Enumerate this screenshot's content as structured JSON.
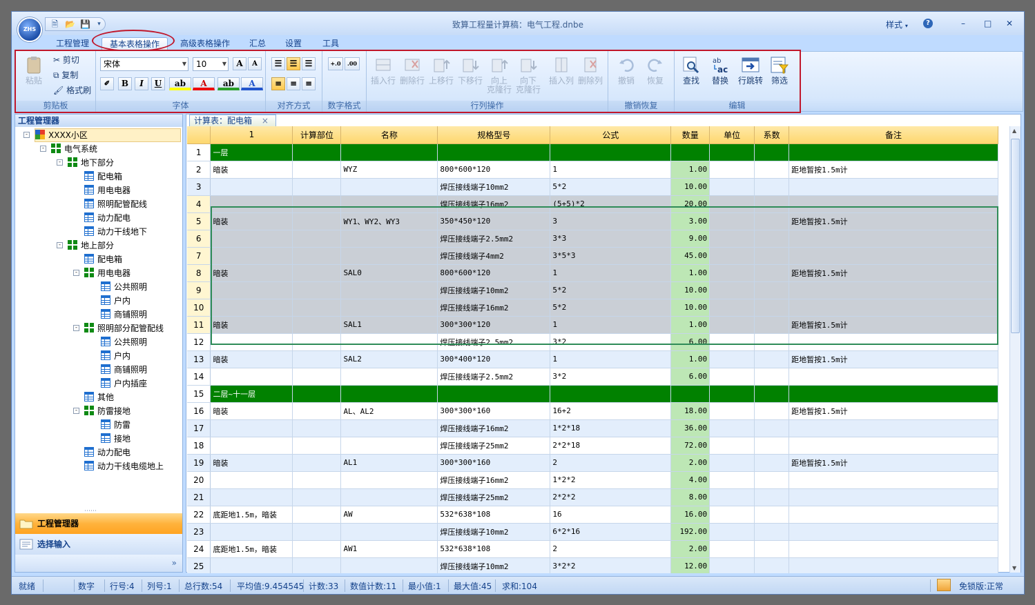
{
  "window": {
    "title": "致算工程量计算稿：电气工程.dnbe",
    "style_label": "样式"
  },
  "qat": {
    "new": "new-doc-icon",
    "open": "open-folder-icon",
    "save": "save-icon"
  },
  "logo_text": "ZHS",
  "tabs": [
    "工程管理",
    "基本表格操作",
    "高级表格操作",
    "汇总",
    "设置",
    "工具"
  ],
  "ribbon": {
    "clipboard": {
      "label": "剪贴板",
      "paste": "粘贴",
      "cut": "剪切",
      "copy": "复制",
      "format_painter": "格式刷"
    },
    "font": {
      "label": "字体",
      "family": "宋体",
      "size": "10"
    },
    "align": {
      "label": "对齐方式"
    },
    "numfmt": {
      "label": "数字格式"
    },
    "rowcol": {
      "label": "行列操作",
      "insert_row": "插入行",
      "delete_row": "删除行",
      "move_up": "上移行",
      "move_down": "下移行",
      "copy_up_1": "向上",
      "copy_up_2": "克隆行",
      "copy_down_1": "向下",
      "copy_down_2": "克隆行",
      "insert_col": "插入列",
      "delete_col": "删除列"
    },
    "undo": {
      "label": "撤销恢复",
      "undo": "撤销",
      "redo": "恢复"
    },
    "edit": {
      "label": "编辑",
      "find": "查找",
      "replace": "替换",
      "goto": "行跳转",
      "filter": "筛选"
    }
  },
  "left_panel": {
    "header": "工程管理器",
    "tree": [
      {
        "label": "XXXX小区",
        "level": 0,
        "icon": "multi",
        "expander": "-",
        "selected": true
      },
      {
        "label": "电气系统",
        "level": 1,
        "icon": "green",
        "expander": "-"
      },
      {
        "label": "地下部分",
        "level": 2,
        "icon": "green",
        "expander": "-"
      },
      {
        "label": "配电箱",
        "level": 3,
        "icon": "grid"
      },
      {
        "label": "用电电器",
        "level": 3,
        "icon": "grid"
      },
      {
        "label": "照明配管配线",
        "level": 3,
        "icon": "grid"
      },
      {
        "label": "动力配电",
        "level": 3,
        "icon": "grid"
      },
      {
        "label": "动力干线地下",
        "level": 3,
        "icon": "grid"
      },
      {
        "label": "地上部分",
        "level": 2,
        "icon": "green",
        "expander": "-"
      },
      {
        "label": "配电箱",
        "level": 3,
        "icon": "grid"
      },
      {
        "label": "用电电器",
        "level": 3,
        "icon": "green",
        "expander": "-"
      },
      {
        "label": "公共照明",
        "level": 4,
        "icon": "grid"
      },
      {
        "label": "户内",
        "level": 4,
        "icon": "grid"
      },
      {
        "label": "商铺照明",
        "level": 4,
        "icon": "grid"
      },
      {
        "label": "照明部分配管配线",
        "level": 3,
        "icon": "green",
        "expander": "-"
      },
      {
        "label": "公共照明",
        "level": 4,
        "icon": "grid"
      },
      {
        "label": "户内",
        "level": 4,
        "icon": "grid"
      },
      {
        "label": "商铺照明",
        "level": 4,
        "icon": "grid"
      },
      {
        "label": "户内插座",
        "level": 4,
        "icon": "grid"
      },
      {
        "label": "其他",
        "level": 3,
        "icon": "grid"
      },
      {
        "label": "防雷接地",
        "level": 3,
        "icon": "green",
        "expander": "-"
      },
      {
        "label": "防雷",
        "level": 4,
        "icon": "grid"
      },
      {
        "label": "接地",
        "level": 4,
        "icon": "grid"
      },
      {
        "label": "动力配电",
        "level": 3,
        "icon": "grid"
      },
      {
        "label": "动力干线电缆地上",
        "level": 3,
        "icon": "grid"
      }
    ],
    "nav_active": "工程管理器",
    "nav_other": "选择输入"
  },
  "sheet": {
    "tab": "计算表：配电箱",
    "tab_close": "×",
    "columns": [
      "1",
      "计算部位",
      "名称",
      "规格型号",
      "公式",
      "数量",
      "单位",
      "系数",
      "备注"
    ],
    "rows": [
      {
        "n": "1",
        "type": "hdr",
        "c": [
          "一层",
          "",
          "",
          "",
          "",
          "",
          "",
          "",
          ""
        ]
      },
      {
        "n": "2",
        "c": [
          "暗装",
          "",
          "WYZ",
          "800*600*120",
          "1",
          "1.00",
          "",
          "",
          "距地暂按1.5m计"
        ]
      },
      {
        "n": "3",
        "c": [
          "",
          "",
          "",
          "焊压接线端子10mm2",
          "5*2",
          "10.00",
          "",
          "",
          ""
        ]
      },
      {
        "n": "4",
        "type": "sel",
        "c": [
          "",
          "",
          "",
          "焊压接线端子16mm2",
          "(5+5)*2",
          "20.00",
          "",
          "",
          ""
        ]
      },
      {
        "n": "5",
        "type": "sel",
        "c": [
          "暗装",
          "",
          "WY1、WY2、WY3",
          "350*450*120",
          "3",
          "3.00",
          "",
          "",
          "距地暂按1.5m计"
        ]
      },
      {
        "n": "6",
        "type": "sel",
        "c": [
          "",
          "",
          "",
          "焊压接线端子2.5mm2",
          "3*3",
          "9.00",
          "",
          "",
          ""
        ]
      },
      {
        "n": "7",
        "type": "sel",
        "c": [
          "",
          "",
          "",
          "焊压接线端子4mm2",
          "3*5*3",
          "45.00",
          "",
          "",
          ""
        ]
      },
      {
        "n": "8",
        "type": "sel",
        "c": [
          "暗装",
          "",
          "SAL0",
          "800*600*120",
          "1",
          "1.00",
          "",
          "",
          "距地暂按1.5m计"
        ]
      },
      {
        "n": "9",
        "type": "sel",
        "c": [
          "",
          "",
          "",
          "焊压接线端子10mm2",
          "5*2",
          "10.00",
          "",
          "",
          ""
        ]
      },
      {
        "n": "10",
        "type": "sel",
        "c": [
          "",
          "",
          "",
          "焊压接线端子16mm2",
          "5*2",
          "10.00",
          "",
          "",
          ""
        ]
      },
      {
        "n": "11",
        "type": "sel",
        "c": [
          "暗装",
          "",
          "SAL1",
          "300*300*120",
          "1",
          "1.00",
          "",
          "",
          "距地暂按1.5m计"
        ]
      },
      {
        "n": "12",
        "c": [
          "",
          "",
          "",
          "焊压接线端子2.5mm2",
          "3*2",
          "6.00",
          "",
          "",
          ""
        ]
      },
      {
        "n": "13",
        "c": [
          "暗装",
          "",
          "SAL2",
          "300*400*120",
          "1",
          "1.00",
          "",
          "",
          "距地暂按1.5m计"
        ]
      },
      {
        "n": "14",
        "c": [
          "",
          "",
          "",
          "焊压接线端子2.5mm2",
          "3*2",
          "6.00",
          "",
          "",
          ""
        ]
      },
      {
        "n": "15",
        "type": "hdr",
        "c": [
          "二层~十一层",
          "",
          "",
          "",
          "",
          "",
          "",
          "",
          ""
        ]
      },
      {
        "n": "16",
        "c": [
          "暗装",
          "",
          "AL、AL2",
          "300*300*160",
          "16+2",
          "18.00",
          "",
          "",
          "距地暂按1.5m计"
        ]
      },
      {
        "n": "17",
        "c": [
          "",
          "",
          "",
          "焊压接线端子16mm2",
          "1*2*18",
          "36.00",
          "",
          "",
          ""
        ]
      },
      {
        "n": "18",
        "c": [
          "",
          "",
          "",
          "焊压接线端子25mm2",
          "2*2*18",
          "72.00",
          "",
          "",
          ""
        ]
      },
      {
        "n": "19",
        "c": [
          "暗装",
          "",
          "AL1",
          "300*300*160",
          "2",
          "2.00",
          "",
          "",
          "距地暂按1.5m计"
        ]
      },
      {
        "n": "20",
        "c": [
          "",
          "",
          "",
          "焊压接线端子16mm2",
          "1*2*2",
          "4.00",
          "",
          "",
          ""
        ]
      },
      {
        "n": "21",
        "c": [
          "",
          "",
          "",
          "焊压接线端子25mm2",
          "2*2*2",
          "8.00",
          "",
          "",
          ""
        ]
      },
      {
        "n": "22",
        "c": [
          "底距地1.5m，暗装",
          "",
          "AW",
          "532*638*108",
          "16",
          "16.00",
          "",
          "",
          ""
        ]
      },
      {
        "n": "23",
        "c": [
          "",
          "",
          "",
          "焊压接线端子10mm2",
          "6*2*16",
          "192.00",
          "",
          "",
          ""
        ]
      },
      {
        "n": "24",
        "c": [
          "底距地1.5m，暗装",
          "",
          "AW1",
          "532*638*108",
          "2",
          "2.00",
          "",
          "",
          ""
        ]
      },
      {
        "n": "25",
        "c": [
          "",
          "",
          "",
          "焊压接线端子10mm2",
          "3*2*2",
          "12.00",
          "",
          "",
          ""
        ]
      }
    ]
  },
  "status": {
    "ready": "就绪",
    "mode": "数字",
    "row": "行号:4",
    "col": "列号:1",
    "total_rows": "总行数:54",
    "avg": "平均值:9.454545",
    "count": "计数:33",
    "num_count": "数值计数:11",
    "min": "最小值:1",
    "max": "最大值:45",
    "sum": "求和:104",
    "license": "免锁版:正常"
  },
  "colors": {
    "header_row": "#018100",
    "qty_col": "#bde7b5",
    "selection": "#cacfd6",
    "accent_border": "#c0172b"
  }
}
